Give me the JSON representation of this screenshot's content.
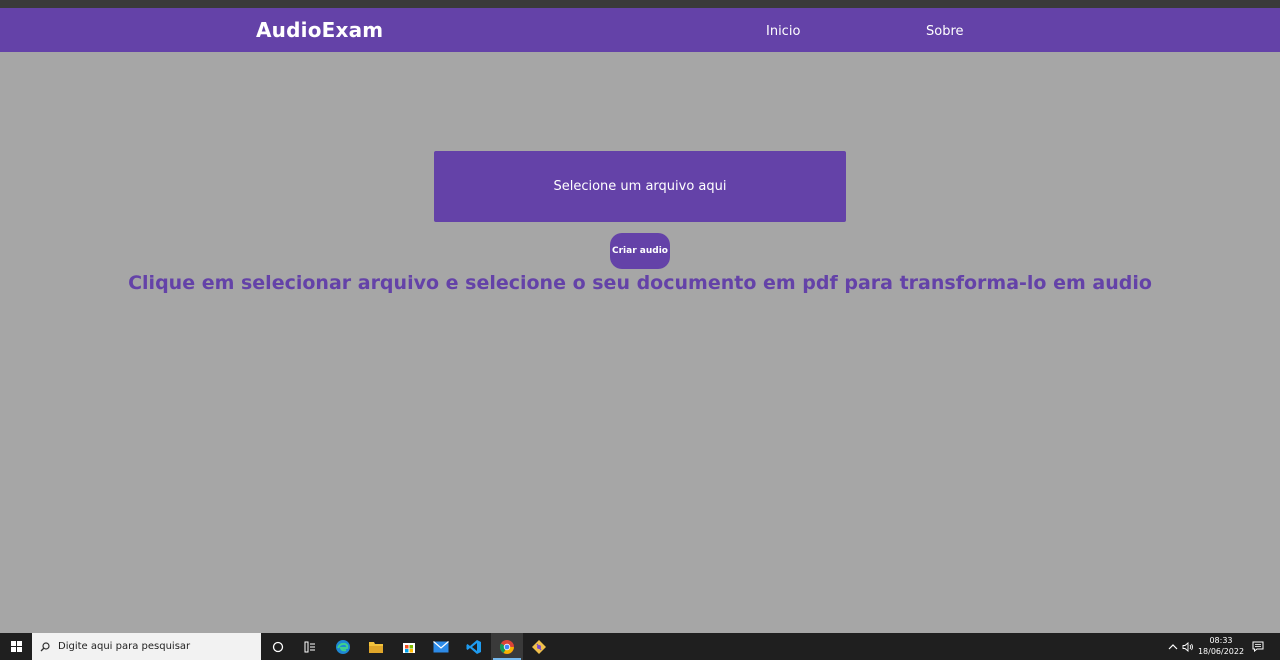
{
  "navbar": {
    "brand": "AudioExam",
    "links": [
      "Inicio",
      "Sobre"
    ]
  },
  "main": {
    "file_select_label": "Selecione um arquivo aqui",
    "create_audio_label": "Criar audio",
    "instructions": "Clique em selecionar arquivo e selecione o seu documento em pdf para transforma-lo em audio"
  },
  "taskbar": {
    "search_placeholder": "Digite aqui para pesquisar",
    "apps": [
      "task-view-icon",
      "widgets-icon",
      "edge-icon",
      "file-explorer-icon",
      "store-icon",
      "mail-icon",
      "vscode-icon",
      "chrome-icon",
      "git-icon"
    ],
    "time": "08:33",
    "date": "18/06/2022"
  },
  "colors": {
    "accent": "#6442a8",
    "background": "#a6a6a6",
    "taskbar": "#1f1f1f"
  }
}
